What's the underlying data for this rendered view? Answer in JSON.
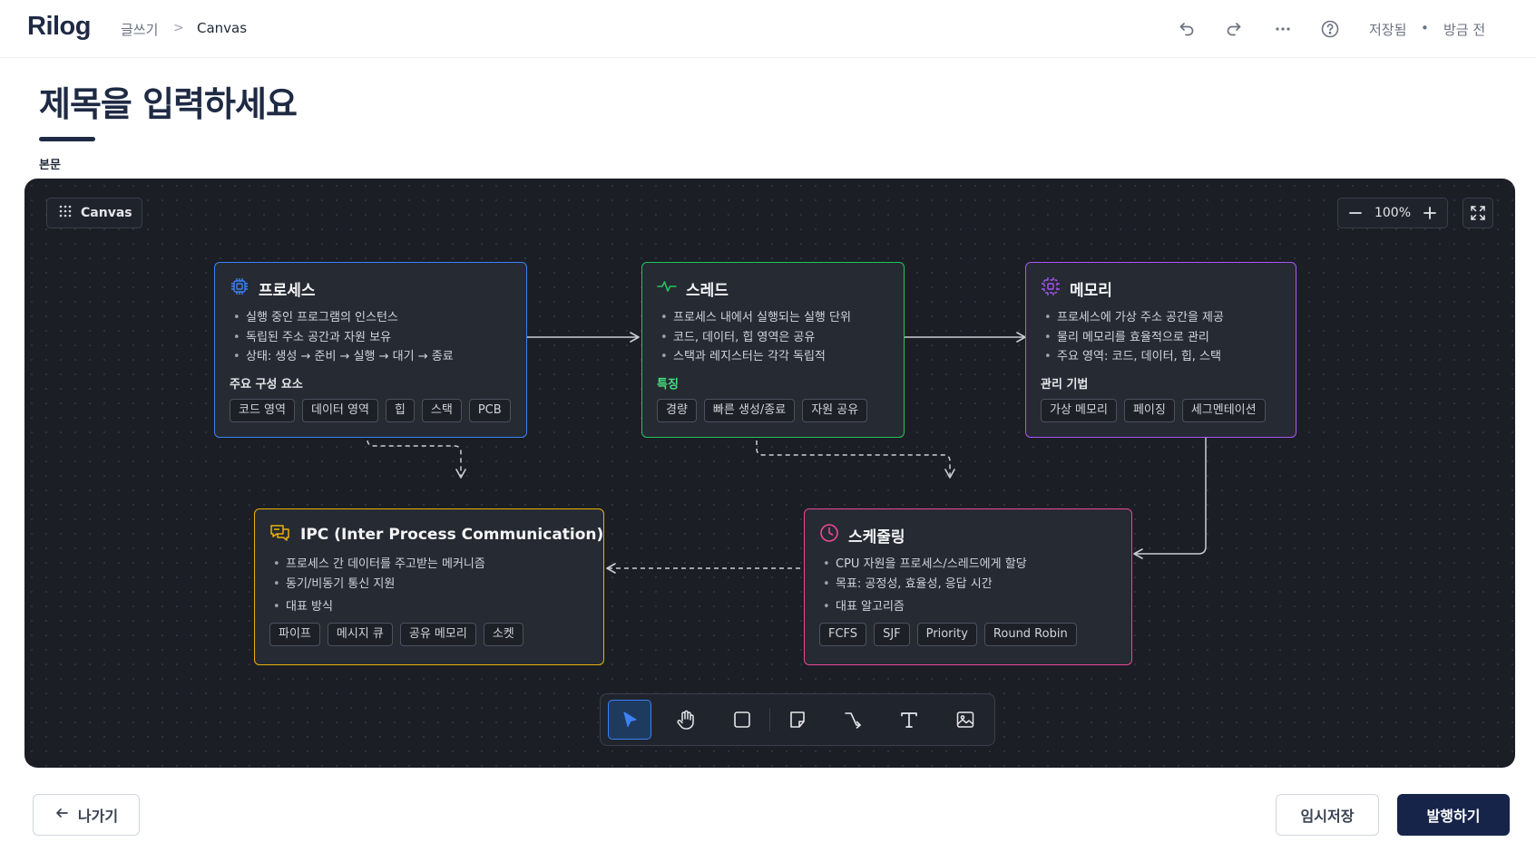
{
  "header": {
    "logo": "Rilog",
    "breadcrumb": {
      "parent": "글쓰기",
      "separator": ">",
      "current": "Canvas"
    },
    "status": {
      "saved": "저장됨",
      "dot": "•",
      "time": "방금 전"
    }
  },
  "editor": {
    "title": "제목을 입력하세요",
    "body_label": "본문"
  },
  "canvas": {
    "badge_label": "Canvas",
    "zoom_level": "100%",
    "nodes": {
      "process": {
        "title": "프로세스",
        "bullets": [
          "실행 중인 프로그램의 인스턴스",
          "독립된 주소 공간과 자원 보유",
          "상태: 생성 → 준비 → 실행 → 대기 → 종료"
        ],
        "section_label": "주요 구성 요소",
        "tags": [
          "코드 영역",
          "데이터 영역",
          "힙",
          "스택",
          "PCB"
        ],
        "accent": "#3b82f6"
      },
      "thread": {
        "title": "스레드",
        "bullets": [
          "프로세스 내에서 실행되는 실행 단위",
          "코드, 데이터, 힙 영역은 공유",
          "스택과 레지스터는 각각 독립적"
        ],
        "section_label": "특징",
        "tags": [
          "경량",
          "빠른 생성/종료",
          "자원 공유"
        ],
        "accent": "#22c55e"
      },
      "memory": {
        "title": "메모리",
        "bullets": [
          "프로세스에 가상 주소 공간을 제공",
          "물리 메모리를 효율적으로 관리",
          "주요 영역: 코드, 데이터, 힙, 스택"
        ],
        "section_label": "관리 기법",
        "tags": [
          "가상 메모리",
          "페이징",
          "세그멘테이션"
        ],
        "accent": "#a855f7"
      },
      "ipc": {
        "title": "IPC (Inter Process Communication)",
        "bullets": [
          "프로세스 간 데이터를 주고받는 메커니즘",
          "동기/비동기 통신 지원"
        ],
        "section_label": "대표 방식",
        "tags": [
          "파이프",
          "메시지 큐",
          "공유 메모리",
          "소켓"
        ],
        "accent": "#eab308"
      },
      "scheduling": {
        "title": "스케줄링",
        "bullets": [
          "CPU 자원을 프로세스/스레드에게 할당",
          "목표: 공정성, 효율성, 응답 시간"
        ],
        "section_label": "대표 알고리즘",
        "tags": [
          "FCFS",
          "SJF",
          "Priority",
          "Round Robin"
        ],
        "accent": "#ec4899"
      }
    },
    "toolbar": [
      "select-tool",
      "hand-tool",
      "rectangle-tool",
      "sticky-note-tool",
      "connector-tool",
      "text-tool",
      "image-tool"
    ]
  },
  "footer": {
    "exit_label": "나가기",
    "draft_label": "임시저장",
    "publish_label": "발행하기"
  }
}
